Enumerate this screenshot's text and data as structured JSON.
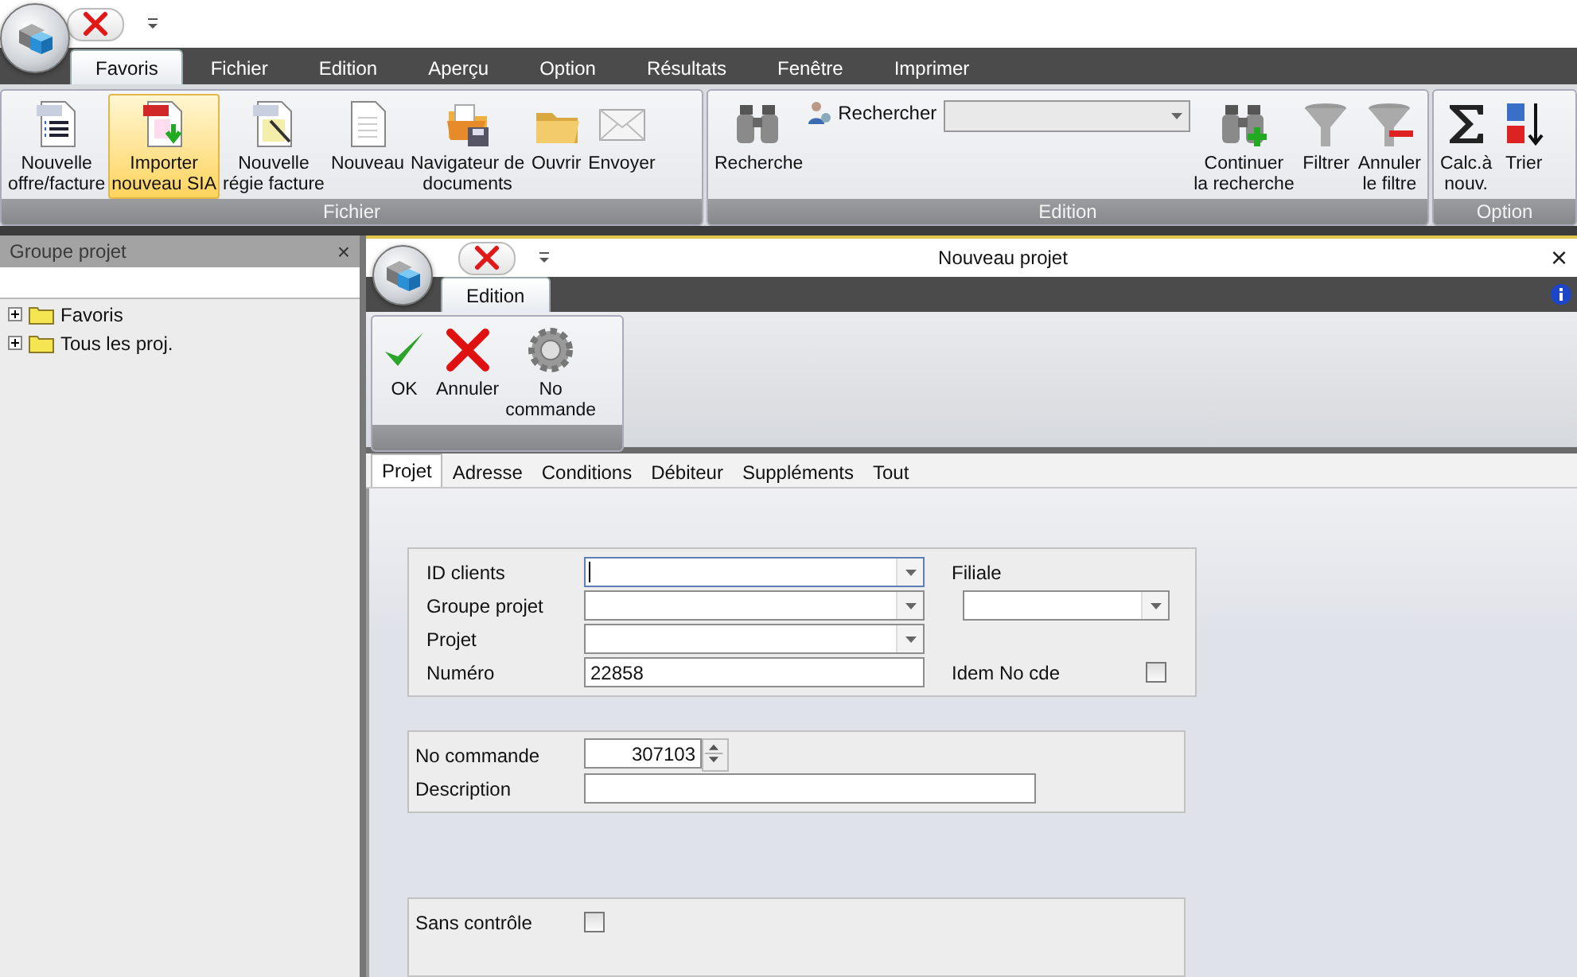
{
  "ribbon": {
    "tabs": [
      {
        "label": "Favoris",
        "selected": true
      },
      {
        "label": "Fichier",
        "selected": false
      },
      {
        "label": "Edition",
        "selected": false
      },
      {
        "label": "Aperçu",
        "selected": false
      },
      {
        "label": "Option",
        "selected": false
      },
      {
        "label": "Résultats",
        "selected": false
      },
      {
        "label": "Fenêtre",
        "selected": false
      },
      {
        "label": "Imprimer",
        "selected": false
      }
    ],
    "groups": [
      {
        "label": "Fichier",
        "items": [
          {
            "kind": "button",
            "label": "Nouvelle\noffre/facture",
            "highlighted": false
          },
          {
            "kind": "button",
            "label": "Importer\nnouveau SIA",
            "highlighted": true
          },
          {
            "kind": "button",
            "label": "Nouvelle\nrégie facture",
            "highlighted": false
          },
          {
            "kind": "button",
            "label": "Nouveau",
            "highlighted": false
          },
          {
            "kind": "button",
            "label": "Navigateur de\ndocuments",
            "highlighted": false
          },
          {
            "kind": "button",
            "label": "Ouvrir",
            "highlighted": false
          },
          {
            "kind": "button",
            "label": "Envoyer",
            "highlighted": false
          }
        ]
      },
      {
        "label": "Edition",
        "items": [
          {
            "kind": "button",
            "label": "Recherche",
            "highlighted": false
          },
          {
            "kind": "combo",
            "label": "Rechercher"
          },
          {
            "kind": "button",
            "label": "Continuer\nla recherche",
            "highlighted": false
          },
          {
            "kind": "button",
            "label": "Filtrer",
            "highlighted": false
          },
          {
            "kind": "button",
            "label": "Annuler\nle filtre",
            "highlighted": false
          }
        ]
      },
      {
        "label": "Option",
        "items": [
          {
            "kind": "button",
            "label": "Calc.à\nnouv.",
            "highlighted": false
          },
          {
            "kind": "button",
            "label": "Trier",
            "highlighted": false
          }
        ]
      }
    ]
  },
  "side_panel": {
    "title": "Groupe projet",
    "close": "×",
    "tree": [
      {
        "label": "Favoris",
        "expanded": false
      },
      {
        "label": "Tous les proj.",
        "expanded": false
      }
    ]
  },
  "dialog": {
    "title": "Nouveau projet",
    "close": "×",
    "tabs": [
      {
        "label": "Edition",
        "selected": true
      }
    ],
    "buttons": [
      {
        "label": "OK"
      },
      {
        "label": "Annuler"
      },
      {
        "label": "No\ncommande"
      }
    ],
    "form_tabs": [
      {
        "label": "Projet",
        "selected": true
      },
      {
        "label": "Adresse",
        "selected": false
      },
      {
        "label": "Conditions",
        "selected": false
      },
      {
        "label": "Débiteur",
        "selected": false
      },
      {
        "label": "Suppléments",
        "selected": false
      },
      {
        "label": "Tout",
        "selected": false
      }
    ],
    "sections": [
      {
        "fields": [
          {
            "label": "ID clients",
            "kind": "combo",
            "focused": true,
            "side": {
              "kind": "label",
              "label": "Filiale"
            }
          },
          {
            "label": "Groupe projet",
            "kind": "combo",
            "focused": false,
            "side": {
              "kind": "combo"
            }
          },
          {
            "label": "Projet",
            "kind": "combo",
            "focused": false
          },
          {
            "label": "Numéro",
            "kind": "text",
            "value": "22858",
            "focused": false,
            "side": {
              "kind": "checkbox",
              "label": "Idem No cde",
              "checked": false
            }
          }
        ]
      },
      {
        "fields": [
          {
            "label": "No commande",
            "kind": "spinner",
            "value": "307103"
          },
          {
            "label": "Description",
            "kind": "wide"
          }
        ]
      },
      {
        "fields": [
          {
            "label": "Sans contrôle",
            "kind": "checkbox",
            "checked": false
          }
        ]
      }
    ]
  }
}
